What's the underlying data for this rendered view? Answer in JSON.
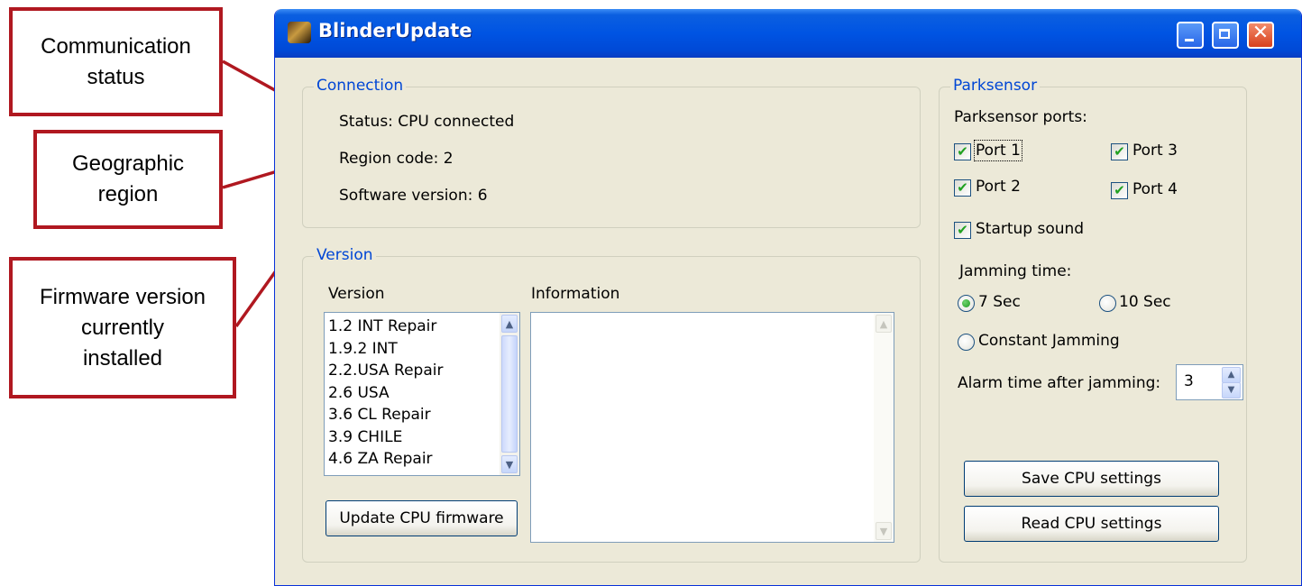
{
  "annotations": {
    "comm_status": [
      "Communication",
      "status"
    ],
    "geo_region": [
      "Geographic",
      "region"
    ],
    "firmware_version": [
      "Firmware version",
      "currently",
      "installed"
    ]
  },
  "window": {
    "title": "BlinderUpdate"
  },
  "connection": {
    "group_title": "Connection",
    "status": "Status: CPU connected",
    "region": "Region code: 2",
    "software": "Software version: 6"
  },
  "version": {
    "group_title": "Version",
    "list_header": "Version",
    "info_header": "Information",
    "items": [
      "1.2 INT Repair",
      "1.9.2 INT",
      "2.2.USA Repair",
      "2.6 USA",
      "3.6 CL Repair",
      "3.9 CHILE",
      "4.6 ZA Repair"
    ],
    "update_button": "Update CPU firmware"
  },
  "parksensor": {
    "group_title": "Parksensor",
    "ports_label": "Parksensor ports:",
    "port1": "Port 1",
    "port2": "Port 2",
    "port3": "Port 3",
    "port4": "Port 4",
    "startup_sound": "Startup sound",
    "jamming_label": "Jamming time:",
    "opt_7": "7 Sec",
    "opt_10": "10 Sec",
    "opt_constant": "Constant Jamming",
    "alarm_label": "Alarm time after jamming:",
    "alarm_value": "3",
    "save_button": "Save CPU settings",
    "read_button": "Read CPU settings"
  },
  "colors": {
    "callout_border": "#b01820",
    "titlebar": "#0054e3",
    "group_title": "#0046d5",
    "window_bg": "#ece9d8"
  },
  "icons": {
    "check": "✔",
    "scroll_up": "▲",
    "scroll_down": "▼",
    "spin_up": "▲",
    "spin_down": "▼",
    "close": "✕"
  }
}
